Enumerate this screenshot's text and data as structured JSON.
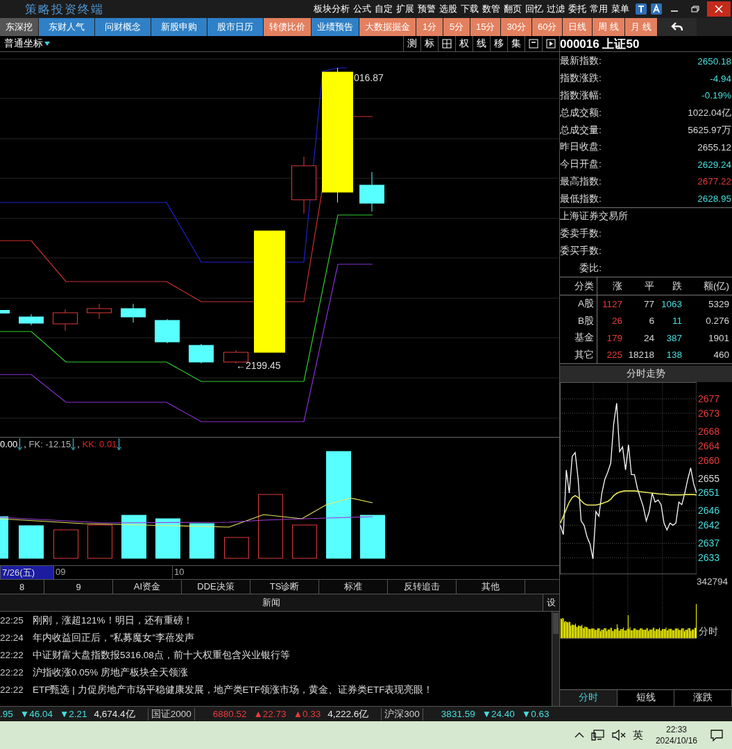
{
  "title_bar": {
    "title": "策略投资终端",
    "menu": [
      "板块分析",
      "公式",
      "自定",
      "扩展",
      "预警",
      "选股",
      "下载",
      "数管",
      "翻页",
      "回忆",
      "过滤",
      "委托",
      "常用",
      "菜单"
    ]
  },
  "quick_tabs": [
    {
      "label": "东深挖",
      "color": "#555555"
    },
    {
      "label": "东财人气",
      "color": "#2f80c6"
    },
    {
      "label": "问财概念",
      "color": "#2f80c6"
    },
    {
      "label": "新股申购",
      "color": "#2f80c6"
    },
    {
      "label": "股市日历",
      "color": "#2f80c6"
    },
    {
      "label": "转债比价",
      "color": "#e3805f"
    },
    {
      "label": "业绩预告",
      "color": "#2f80c6"
    },
    {
      "label": "大数据掘金",
      "color": "#e3805f"
    },
    {
      "label": "1分",
      "color": "#e3805f"
    },
    {
      "label": "5分",
      "color": "#e3805f"
    },
    {
      "label": "15分",
      "color": "#e3805f"
    },
    {
      "label": "30分",
      "color": "#e3805f"
    },
    {
      "label": "60分",
      "color": "#e3805f"
    },
    {
      "label": "日线",
      "color": "#e3805f"
    },
    {
      "label": "周 线",
      "color": "#e3805f"
    },
    {
      "label": "月 线",
      "color": "#e3805f"
    }
  ],
  "toolbar": {
    "coordinate_mode": "普通坐标",
    "tools": [
      {
        "kind": "text",
        "label": "测"
      },
      {
        "kind": "text",
        "label": "标"
      },
      {
        "kind": "grid"
      },
      {
        "kind": "text",
        "label": "权"
      },
      {
        "kind": "text",
        "label": "线"
      },
      {
        "kind": "text",
        "label": "移"
      },
      {
        "kind": "text",
        "label": "集"
      },
      {
        "kind": "window"
      },
      {
        "kind": "play"
      }
    ]
  },
  "kline": {
    "labels": [
      "016.87",
      "←2199.45"
    ]
  },
  "indicator": {
    "items": [
      {
        "text": "0.00",
        "color": "#ffffff"
      },
      {
        "sep": ", ",
        "text": "FK: -12.15",
        "color": "#b4b4b4"
      },
      {
        "sep": ", ",
        "text": "KK: 0.01",
        "color": "#e02020"
      }
    ]
  },
  "x_axis": [
    {
      "label": "7/26(五)",
      "selected": true
    },
    {
      "label": "09",
      "selected": false
    },
    {
      "label": "10",
      "selected": false
    }
  ],
  "bottom_tabs": [
    "8",
    "9",
    "AI资金",
    "DDE决策",
    "TS诊断",
    "标准",
    "反转追击",
    "其他"
  ],
  "news": {
    "title": "新闻",
    "settings": "设",
    "items": [
      {
        "time": "22:25",
        "title": "刚刚，涨超121%！明日，还有重磅！"
      },
      {
        "time": "22:24",
        "title": "年内收益回正后，“私募魔女”李蓓发声"
      },
      {
        "time": "22:22",
        "title": "中证财富大盘指数报5316.08点，前十大权重包含兴业银行等"
      },
      {
        "time": "22:22",
        "title": "沪指收涨0.05% 房地产板块全天领涨"
      },
      {
        "time": "22:22",
        "title": "ETF甄选 | 力促房地产市场平稳健康发展，地产类ETF领涨市场，黄金、证券类ETF表现亮眼！"
      }
    ]
  },
  "quote": {
    "code": "000016",
    "name": "上证50",
    "stats": [
      {
        "label": "最新指数:",
        "value": "2650.18",
        "color": "#48dede"
      },
      {
        "label": "指数涨跌:",
        "value": "-4.94",
        "color": "#48dede"
      },
      {
        "label": "指数涨幅:",
        "value": "-0.19%",
        "color": "#48dede"
      },
      {
        "label": "总成交额:",
        "value": "1022.04亿",
        "color": "#d8d8d8"
      },
      {
        "label": "总成交量:",
        "value": "5625.97万",
        "color": "#d8d8d8"
      },
      {
        "label": "昨日收盘:",
        "value": "2655.12",
        "color": "#d8d8d8"
      },
      {
        "label": "今日开盘:",
        "value": "2629.24",
        "color": "#48dede"
      },
      {
        "label": "最高指数:",
        "value": "2677.22",
        "color": "#e83b3b"
      },
      {
        "label": "最低指数:",
        "value": "2628.95",
        "color": "#48dede"
      }
    ],
    "exchange": "上海证券交易所",
    "order_stats": [
      "委卖手数:",
      "委买手数:",
      "委比:"
    ],
    "breadth": {
      "columns": [
        "分类",
        "涨",
        "平",
        "跌",
        "额(亿)"
      ],
      "rows": [
        {
          "category": "A股",
          "up": "1127",
          "flat": "77",
          "down": "1063",
          "amount": "5329"
        },
        {
          "category": "B股",
          "up": "26",
          "flat": "6",
          "down": "11",
          "amount": "0.276"
        },
        {
          "category": "基金",
          "up": "179",
          "flat": "24",
          "down": "387",
          "amount": "1901"
        },
        {
          "category": "其它",
          "up": "225",
          "flat": "18218",
          "down": "138",
          "amount": "460"
        }
      ]
    }
  },
  "intraday": {
    "title": "分时走势",
    "chart_data": {
      "type": "line",
      "ylim": [
        2628.5,
        2681.5
      ],
      "yticks": [
        2633,
        2637,
        2642,
        2646,
        2651,
        2655,
        2660,
        2664,
        2668,
        2673,
        2677
      ],
      "grid": true,
      "series": [
        {
          "color": "#ffffff",
          "values": [
            2642.0,
            2639.4,
            2657.3,
            2650.9,
            2661.1,
            2662.1,
            2654.7,
            2643.2,
            2642.0,
            2638.8,
            2636.8,
            2632.7,
            2645.8,
            2644.5,
            2650.9,
            2654.7,
            2656.7,
            2659.2,
            2670.1,
            2675.8,
            2662.4,
            2663.7,
            2657.3,
            2664.3,
            2656.0,
            2656.0,
            2652.2,
            2649.6,
            2647.1,
            2643.2,
            2645.8,
            2650.9,
            2648.4,
            2649.0,
            2647.7,
            2642.6,
            2640.7,
            2642.6,
            2642.0,
            2642.6,
            2648.4,
            2647.7,
            2650.9,
            2654.7,
            2657.9,
            2653.5,
            2650.9
          ]
        },
        {
          "color": "#e8e860",
          "values": [
            2642.6,
            2644.5,
            2646.5,
            2648.4,
            2649.7,
            2650.2,
            2649.7,
            2648.8,
            2648.0,
            2647.6,
            2647.6,
            2647.6,
            2647.6,
            2647.8,
            2648.0,
            2648.3,
            2648.6,
            2649.2,
            2650.2,
            2650.8,
            2651.2,
            2651.4,
            2651.5,
            2651.5,
            2651.5,
            2651.5,
            2651.4,
            2651.3,
            2651.2,
            2651.1,
            2651.0,
            2650.9,
            2650.8,
            2650.7,
            2650.6,
            2650.6,
            2650.5,
            2650.4,
            2650.4,
            2650.4,
            2650.4,
            2650.4,
            2650.5,
            2650.5,
            2650.5,
            2650.5,
            2650.4
          ]
        }
      ]
    },
    "volume_max": "342794",
    "volume_label": "分时",
    "tabs": [
      {
        "label": "分时",
        "selected": true
      },
      {
        "label": "短线",
        "selected": false
      },
      {
        "label": "涨跌",
        "selected": false
      }
    ]
  },
  "status_bar": [
    {
      "text": ".95",
      "kind": "value",
      "color": "#48dede"
    },
    {
      "text": "▼46.04",
      "kind": "value",
      "color": "#48dede"
    },
    {
      "text": "▼2.21",
      "kind": "value",
      "color": "#48dede"
    },
    {
      "text": "4,674.4亿",
      "kind": "value"
    },
    {
      "text": "国证2000",
      "kind": "index"
    },
    {
      "text": "6880.52",
      "kind": "value",
      "color": "#e83b3b"
    },
    {
      "text": "▲22.73",
      "kind": "value",
      "color": "#e83b3b"
    },
    {
      "text": "▲0.33",
      "kind": "value",
      "color": "#e83b3b"
    },
    {
      "text": "4,222.6亿",
      "kind": "value"
    },
    {
      "text": "沪深300",
      "kind": "index"
    },
    {
      "text": "3831.59",
      "kind": "value",
      "color": "#48dede"
    },
    {
      "text": "▼24.40",
      "kind": "value",
      "color": "#48dede"
    },
    {
      "text": "▼0.63",
      "kind": "value",
      "color": "#48dede"
    }
  ],
  "taskbar": {
    "input_method": "英",
    "time": "22:33",
    "date": "2024/10/16"
  }
}
